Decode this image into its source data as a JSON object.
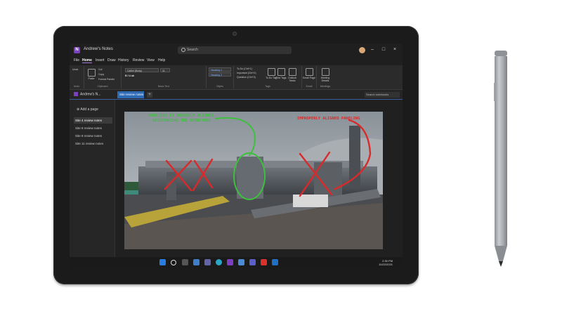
{
  "window": {
    "title": "Andrew's Notes",
    "app_letter": "N"
  },
  "search": {
    "placeholder": "Search"
  },
  "window_buttons": {
    "minimize": "–",
    "maximize": "□",
    "close": "×"
  },
  "menu": [
    "File",
    "Home",
    "Insert",
    "Draw",
    "History",
    "Review",
    "View",
    "Help"
  ],
  "menu_active": "Home",
  "ribbon": {
    "undo": "Undo",
    "paste": "Paste",
    "cut": "Cut",
    "copy": "Copy",
    "format_painter": "Format Painter",
    "font": "Calibri (Body)",
    "font_size": "11",
    "heading1": "Heading 1",
    "heading2": "Heading 2",
    "todo": "To Do (Ctrl+1)",
    "important": "Important (Ctrl+2)",
    "question": "Question (Ctrl+3)",
    "todo_tag": "To Do Tag",
    "find_tags": "Find Tags",
    "outlook_tasks": "Outlook Tasks",
    "email_page": "Email Page",
    "meeting_details": "Meeting Details",
    "groups": [
      "Undo",
      "Clipboard",
      "Basic Text",
      "Styles",
      "Tags",
      "Email",
      "Meetings"
    ]
  },
  "notebook": {
    "name": "Andrew's N...",
    "section_tab": "Site review notes",
    "add_tab": "+",
    "search": "Search notebooks"
  },
  "pages": {
    "add_page": "Add a page",
    "items": [
      "Site 4 review notes",
      "Site 8 review notes",
      "Site 9 review notes",
      "Site 11 review notes"
    ],
    "selected": 0
  },
  "annotations": {
    "left_line1": "PANELING IS PROPERLY ALIGNED,",
    "left_line2": "REINFORCING THE STRUCTURE",
    "right": "IMPROPERLY ALIGNED PANELING"
  },
  "colors": {
    "accent": "#7b3fbf",
    "tab_blue": "#2f6bb5",
    "ink_green": "#3fbf3f",
    "ink_red": "#d82a2a"
  },
  "taskbar": {
    "icons": [
      "windows-icon",
      "search-icon",
      "task-view-icon",
      "widgets-icon",
      "teams-icon",
      "edge-icon",
      "onenote-icon",
      "store-icon",
      "teams-app-icon",
      "acrobat-icon",
      "outlook-icon"
    ],
    "time": "2:30 PM",
    "date": "10/22/2021"
  }
}
